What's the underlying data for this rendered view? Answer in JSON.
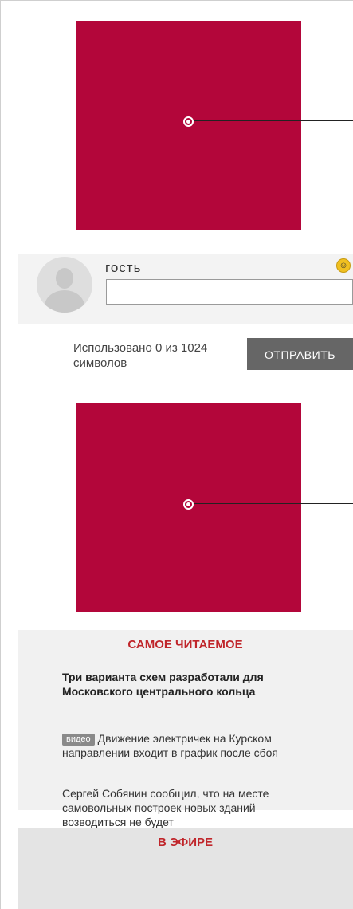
{
  "ads": {
    "top_color": "#b3063a",
    "mid_color": "#b3063a"
  },
  "comment": {
    "user_name": "гость",
    "input_value": "",
    "smiley_icon": "smiley-icon"
  },
  "counter": {
    "text": "Использовано 0 из 1024 символов"
  },
  "send_button": {
    "label": "ОТПРАВИТЬ"
  },
  "most_read": {
    "title": "САМОЕ ЧИТАЕМОЕ",
    "items": [
      {
        "text": "Три варианта схем разработали для Московского центрального кольца"
      },
      {
        "badge": "видео",
        "text": "Движение электричек на Курском направлении входит в график после сбоя"
      },
      {
        "text": "Сергей Собянин сообщил, что на месте самовольных построек новых зданий возводиться не будет"
      }
    ]
  },
  "on_air": {
    "title": "В ЭФИРЕ"
  }
}
